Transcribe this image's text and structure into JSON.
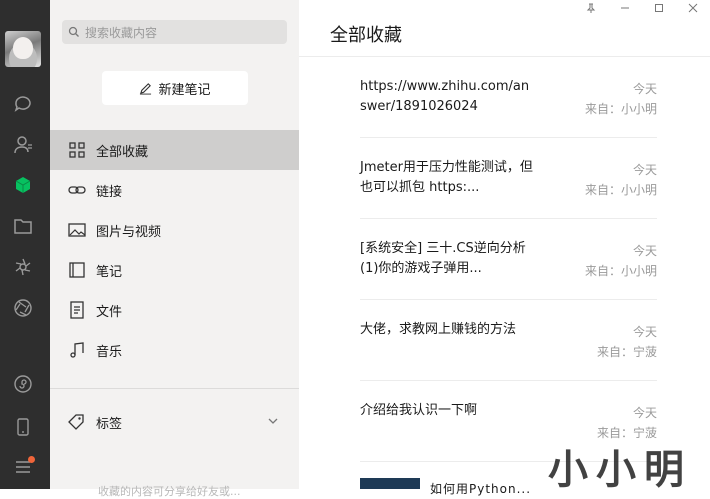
{
  "search": {
    "placeholder": "搜索收藏内容"
  },
  "new_note": {
    "label": "新建笔记"
  },
  "menu": [
    {
      "label": "全部收藏",
      "icon": "grid-icon",
      "active": true
    },
    {
      "label": "链接",
      "icon": "link-icon"
    },
    {
      "label": "图片与视频",
      "icon": "image-icon"
    },
    {
      "label": "笔记",
      "icon": "notebook-icon"
    },
    {
      "label": "文件",
      "icon": "file-icon"
    },
    {
      "label": "音乐",
      "icon": "music-icon"
    }
  ],
  "tags": {
    "label": "标签"
  },
  "footer_faded": "收藏的内容可分享给好友或...",
  "main": {
    "title": "全部收藏",
    "items": [
      {
        "text": "https://www.zhihu.com/answer/1891026024",
        "date": "今天",
        "from": "来自：小小明"
      },
      {
        "text": "Jmeter用于压力性能测试，但也可以抓包 https:...",
        "date": "今天",
        "from": "来自：小小明"
      },
      {
        "text": "[系统安全] 三十.CS逆向分析 (1)你的游戏子弹用...",
        "date": "今天",
        "from": "来自：小小明"
      },
      {
        "text": "大佬，求教网上赚钱的方法",
        "date": "今天",
        "from": "来自：宁菠"
      },
      {
        "text": "介绍给我认识一下啊",
        "date": "今天",
        "from": "来自：宁菠"
      }
    ],
    "partial_text": "如何用Python..."
  },
  "watermark": "小小明",
  "colors": {
    "rail_bg": "#2e2e2e",
    "accent": "#07c160",
    "badge": "#f0653a",
    "sidebar_bg": "#f3f2f1"
  }
}
